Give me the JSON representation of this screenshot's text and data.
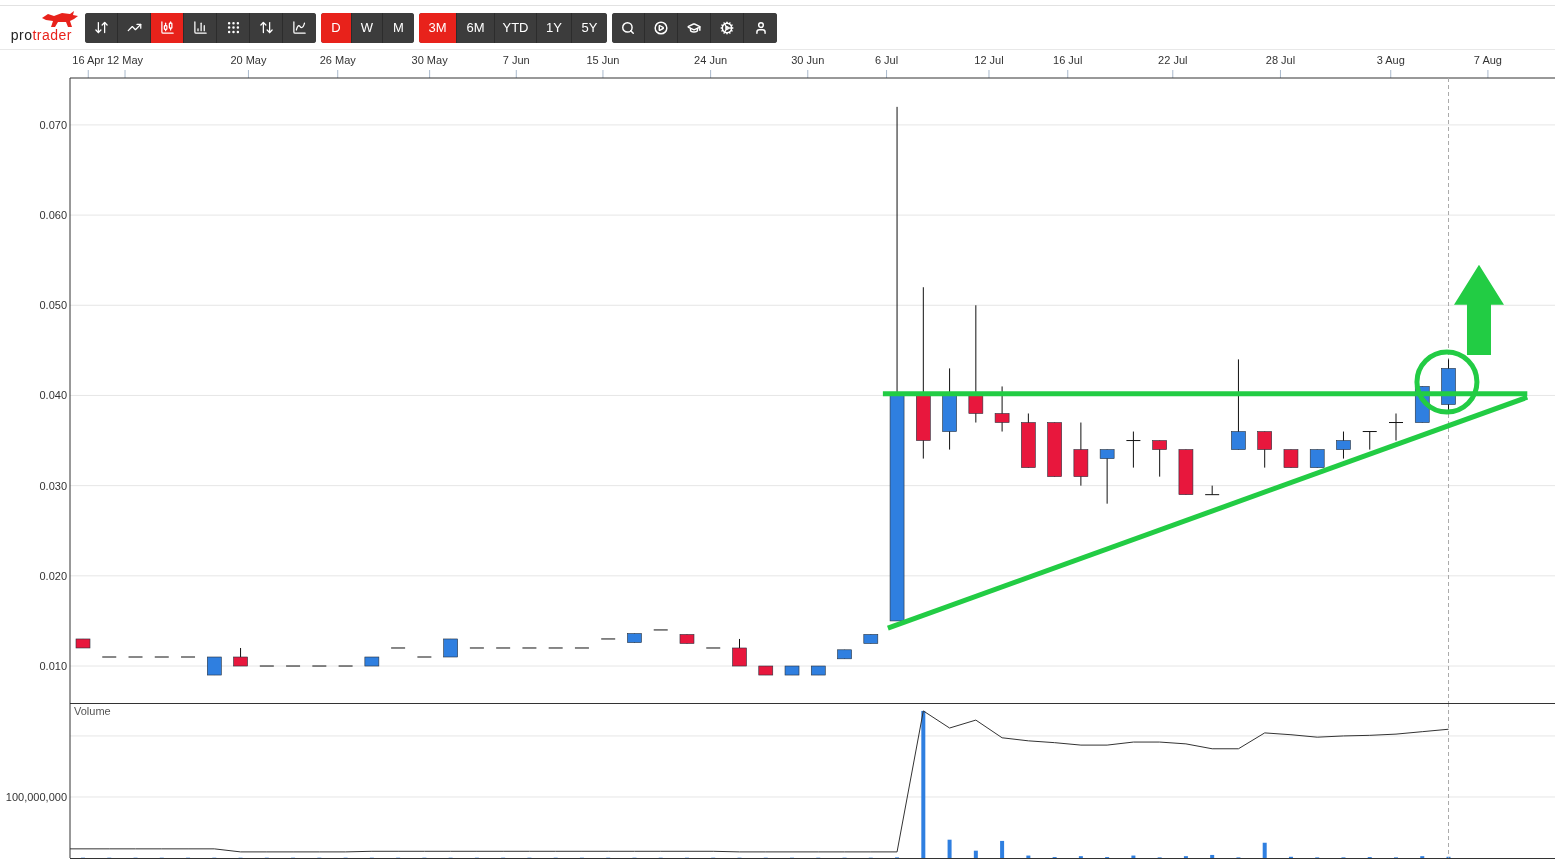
{
  "logo": {
    "prefix": "pro",
    "suffix": "trader"
  },
  "chart_types": [
    {
      "selected": false
    },
    {
      "selected": false
    },
    {
      "selected": true
    },
    {
      "selected": false
    },
    {
      "selected": false
    },
    {
      "selected": false
    },
    {
      "selected": false
    }
  ],
  "periods": [
    {
      "label": "D",
      "selected": true
    },
    {
      "label": "W",
      "selected": false
    },
    {
      "label": "M",
      "selected": false
    }
  ],
  "ranges": [
    {
      "label": "3M",
      "selected": true
    },
    {
      "label": "6M",
      "selected": false
    },
    {
      "label": "YTD",
      "selected": false
    },
    {
      "label": "1Y",
      "selected": false
    },
    {
      "label": "5Y",
      "selected": false
    }
  ],
  "price_chart": {
    "x_labels": [
      "16 Apr",
      "12 May",
      "20 May",
      "26 May",
      "30 May",
      "7 Jun",
      "15 Jun",
      "24 Jun",
      "30 Jun",
      "6 Jul",
      "12 Jul",
      "16 Jul",
      "22 Jul",
      "28 Jul",
      "3 Aug",
      "7 Aug"
    ],
    "y_labels": [
      "0.070",
      "0.060",
      "0.050",
      "0.040",
      "0.030",
      "0.020",
      "0.010"
    ]
  },
  "volume_chart": {
    "title": "Volume",
    "y_label": "100,000,000"
  }
}
